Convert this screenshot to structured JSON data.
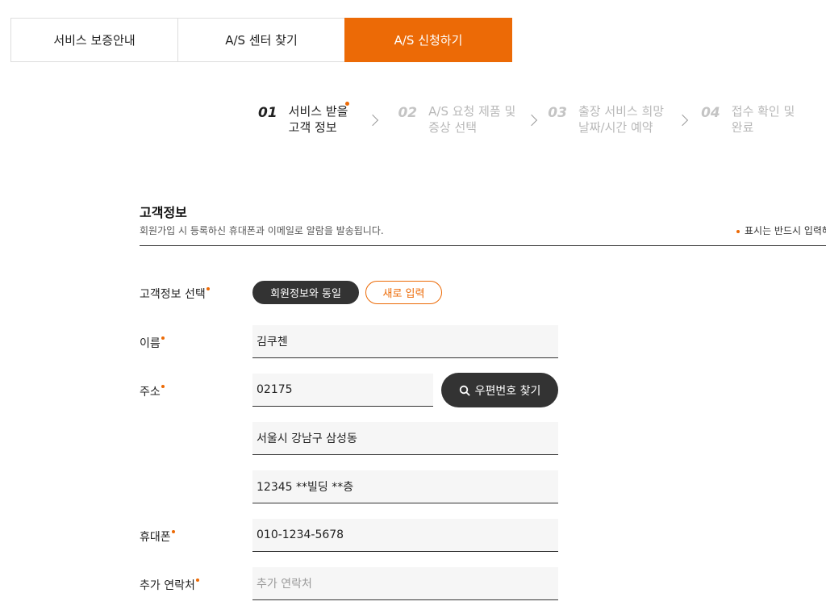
{
  "tabs": [
    {
      "label": "서비스 보증안내",
      "active": false
    },
    {
      "label": "A/S 센터 찾기",
      "active": false
    },
    {
      "label": "A/S 신청하기",
      "active": true
    }
  ],
  "steps": [
    {
      "num": "01",
      "label": "서비스 받을\n고객 정보",
      "active": true
    },
    {
      "num": "02",
      "label": "A/S 요청 제품 및\n증상 선택",
      "active": false
    },
    {
      "num": "03",
      "label": "출장 서비스 희망\n날짜/시간 예약",
      "active": false
    },
    {
      "num": "04",
      "label": "접수 확인 및\n완료",
      "active": false
    }
  ],
  "section": {
    "title": "고객정보",
    "description": "회원가입 시 등록하신 휴대폰과 이메일로 알람을 발송됩니다.",
    "required_note": "표시는 반드시 입력해"
  },
  "form": {
    "customer_select": {
      "label": "고객정보 선택",
      "option_same": "회원정보와 동일",
      "option_new": "새로 입력"
    },
    "name": {
      "label": "이름",
      "value": "김쿠첸"
    },
    "address": {
      "label": "주소",
      "zipcode": "02175",
      "zip_button": "우편번호 찾기",
      "line1": "서울시 강남구 삼성동",
      "line2": "12345 **빌딩 **층"
    },
    "phone": {
      "label": "휴대폰",
      "value": "010-1234-5678"
    },
    "extra_contact": {
      "label": "추가 연락처",
      "placeholder": "추가 연락처"
    }
  },
  "colors": {
    "accent": "#ec6a06",
    "dark_button": "#333333",
    "field_bg": "#f6f6f6"
  },
  "icons": {
    "step_separator": "chevron-right-icon",
    "zip_button": "search-icon",
    "required_marker": "required-dot-icon"
  }
}
